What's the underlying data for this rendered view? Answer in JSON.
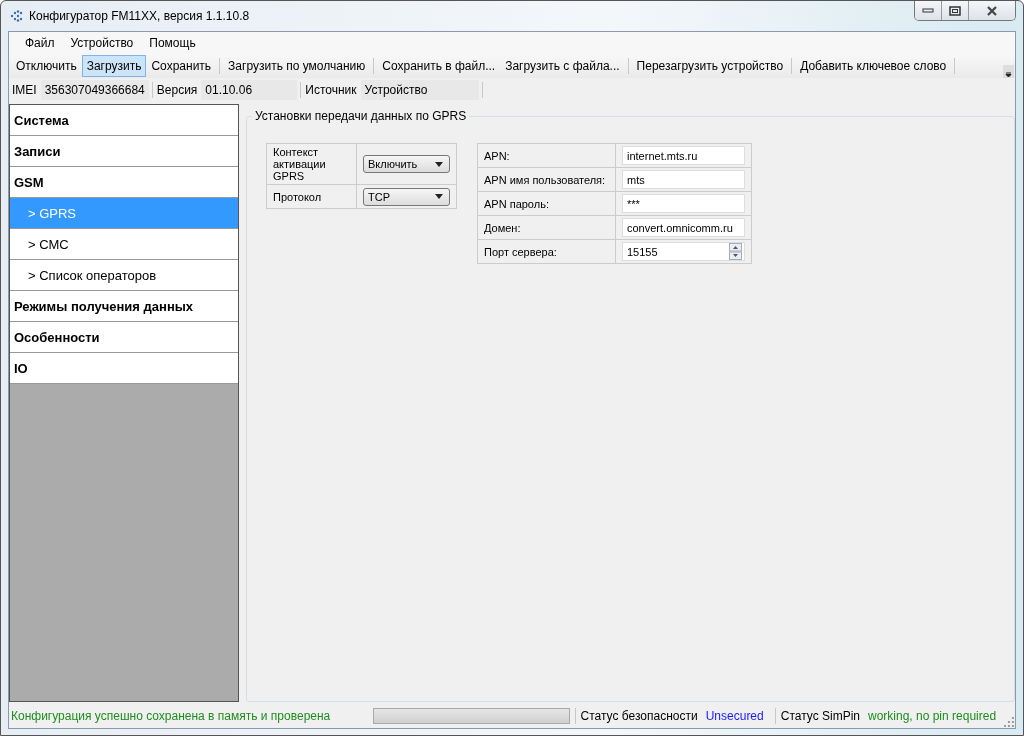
{
  "window": {
    "title": "Конфигуратор FM11XX, версия 1.1.10.8"
  },
  "menu": [
    "Файл",
    "Устройство",
    "Помощь"
  ],
  "toolbar": [
    {
      "label": "Отключить",
      "selected": false
    },
    {
      "label": "Загрузить",
      "selected": true
    },
    {
      "label": "Сохранить",
      "selected": false
    },
    {
      "label": "Загрузить по умолчанию",
      "selected": false
    },
    {
      "label": "Сохранить в файл...",
      "selected": false
    },
    {
      "label": "Загрузить с файла...",
      "selected": false
    },
    {
      "label": "Перезагрузить устройство",
      "selected": false
    },
    {
      "label": "Добавить ключевое слово",
      "selected": false
    }
  ],
  "info": [
    {
      "label": "IMEI",
      "value": "356307049366684"
    },
    {
      "label": "Версия",
      "value": "01.10.06"
    },
    {
      "label": "Источник",
      "value": "Устройство"
    }
  ],
  "sidebar": {
    "items": [
      {
        "label": "Система",
        "selected": false
      },
      {
        "label": "Записи",
        "selected": false
      },
      {
        "label": "GSM",
        "selected": false,
        "children": [
          {
            "label": "> GPRS",
            "selected": true
          },
          {
            "label": "> СМС",
            "selected": false
          },
          {
            "label": "> Список операторов",
            "selected": false
          }
        ]
      },
      {
        "label": "Режимы получения данных",
        "selected": false
      },
      {
        "label": "Особенности",
        "selected": false
      },
      {
        "label": "IO",
        "selected": false
      }
    ]
  },
  "group": {
    "title": "Установки передачи данных по GPRS",
    "selects": [
      {
        "label": "Контекст активации GPRS",
        "value": "Включить"
      },
      {
        "label": "Протокол",
        "value": "TCP"
      }
    ],
    "fields": [
      {
        "label": "APN:",
        "value": "internet.mts.ru",
        "kind": "text"
      },
      {
        "label": "APN имя пользователя:",
        "value": "mts",
        "kind": "text"
      },
      {
        "label": "APN пароль:",
        "value": "***",
        "kind": "text"
      },
      {
        "label": "Домен:",
        "value": "convert.omnicomm.ru",
        "kind": "text"
      },
      {
        "label": "Порт сервера:",
        "value": "15155",
        "kind": "number"
      }
    ]
  },
  "status_bar": {
    "message": {
      "text": "Конфигурация успешно сохранена в память и проверена",
      "color": "#1e8c1e"
    },
    "progress": {
      "level": 0
    },
    "items": [
      {
        "label": "Статус безопасности",
        "value": "Unsecured",
        "color": "#1a1aff"
      },
      {
        "label": "Статус SimPin",
        "value": "working, no pin required",
        "color": "#1e8c1e"
      }
    ]
  }
}
